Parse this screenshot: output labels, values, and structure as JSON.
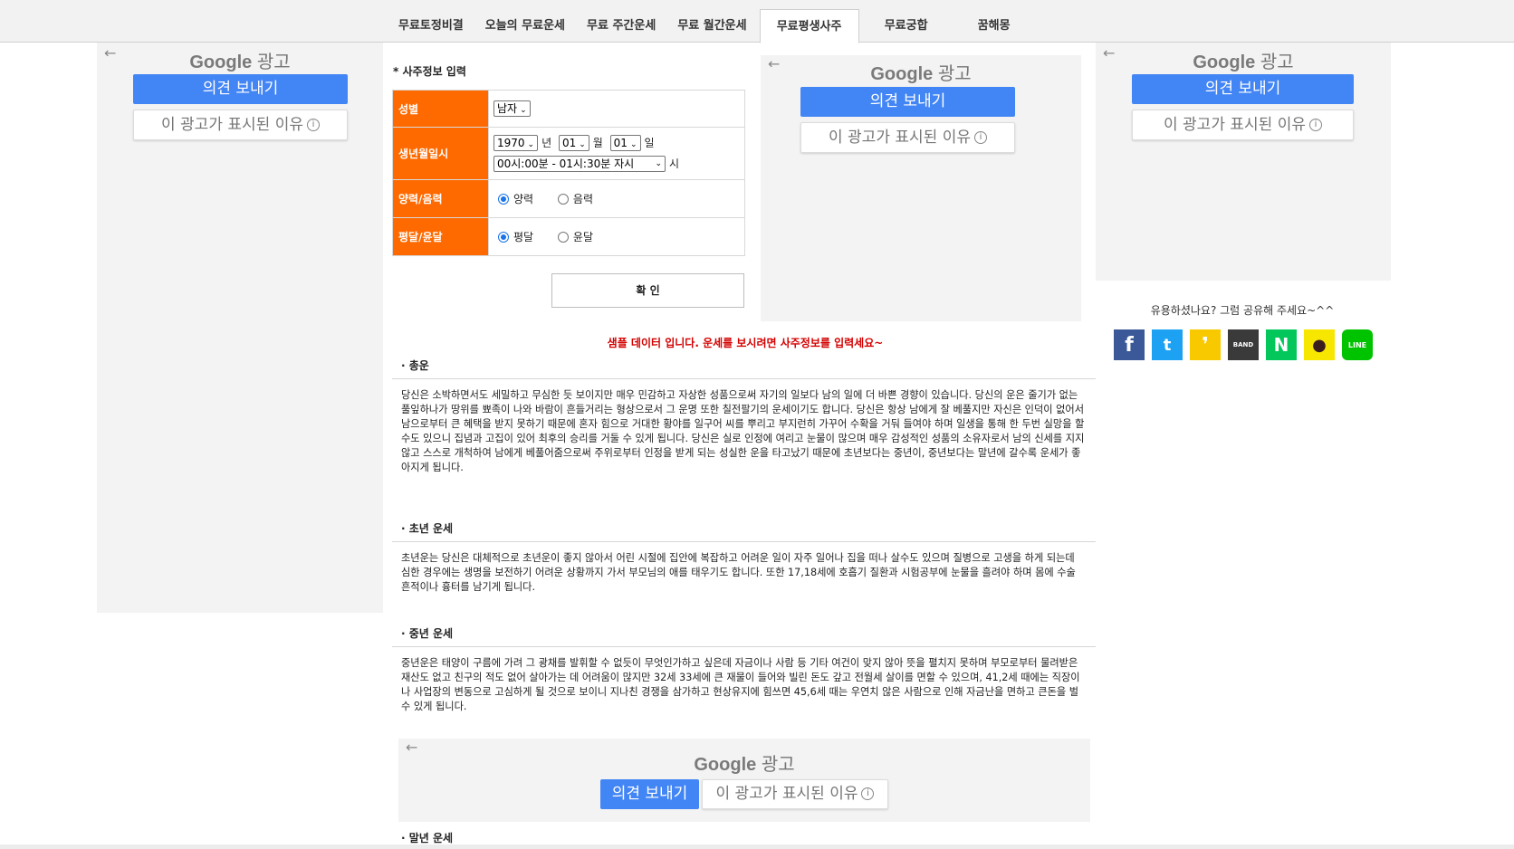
{
  "nav": {
    "tabs": [
      {
        "label": "무료토정비결"
      },
      {
        "label": "오늘의 무료운세"
      },
      {
        "label": "무료 주간운세"
      },
      {
        "label": "무료 월간운세"
      },
      {
        "label": "무료평생사주",
        "active": true
      },
      {
        "label": "무료궁합"
      },
      {
        "label": "꿈해몽"
      }
    ]
  },
  "ads": {
    "logo_google": "Google",
    "logo_ad": "광고",
    "feedback": "의견 보내기",
    "why": "이 광고가 표시된 이유",
    "back_arrow": "←"
  },
  "form": {
    "title": "* 사주정보 입력",
    "gender_label": "성별",
    "gender_value": "남자",
    "birth_label": "생년월일시",
    "year_value": "1970",
    "year_unit": "년",
    "month_value": "01",
    "month_unit": "월",
    "day_value": "01",
    "day_unit": "일",
    "time_value": "00시:00분 - 01시:30분 자시",
    "time_unit": "시",
    "calendar_label": "양력/음력",
    "solar": "양력",
    "lunar": "음력",
    "leap_label": "평달/윤달",
    "normal_month": "평달",
    "leap_month": "윤달",
    "confirm": "확 인"
  },
  "notice": "샘플 데이터 입니다. 운세를 보시려면 사주정보를 입력세요~",
  "sections": {
    "total": {
      "title": "· 총운",
      "body": "당신은 소박하면서도 세밀하고 무심한 듯 보이지만 매우 민감하고 자상한 성품으로써 자기의 일보다 남의 일에 더 바쁜 경향이 있습니다. 당신의 운은 줄기가 없는 풀잎하나가 땅위를 뾰족이 나와 바람이 흔들거리는 형상으로서 그 운명 또한 칠전팔기의 운세이기도 합니다. 당신은 항상 남에게 잘 베풀지만 자신은 인덕이 없어서 남으로부터 큰 혜택을 받지 못하기 때문에 혼자 힘으로 거대한 황야를 일구어 씨를 뿌리고 부지런히 가꾸어 수확을 거둬 들여야 하며 일생을 통해 한 두번 실망을 할 수도 있으니 집념과 고집이 있어 최후의 승리를 거둘 수 있게 됩니다. 당신은 실로 인정에 여리고 눈물이 많으며 매우 감성적인 성품의 소유자로서 남의 신세를 지지 않고 스스로 개척하여 남에게 베풀어줌으로써 주위로부터 인정을 받게 되는 성실한 운을 타고났기 때문에 초년보다는 중년이, 중년보다는 말년에 갈수록 운세가 좋아지게 됩니다."
    },
    "early": {
      "title": "· 초년 운세",
      "body": "초년운는 당신은 대체적으로 초년운이 좋지 않아서 어린 시절에 집안에 복잡하고 어려운 일이 자주 일어나 집을 떠나 살수도 있으며 질병으로 고생을 하게 되는데 심한 경우에는 생명을 보전하기 어려운 상황까지 가서 부모님의 애를 태우기도 합니다. 또한 17,18세에 호흡기 질환과 시험공부에 눈물을 흘려야 하며 몸에 수술 흔적이나 흉터를 남기게 됩니다."
    },
    "middle": {
      "title": "· 중년 운세",
      "body": "중년운은 태양이 구름에 가려 그 광채를 발휘할 수 없듯이 무엇인가하고 싶은데 자금이나 사람 등 기타 여건이 맞지 않아 뜻을 펼치지 못하며 부모로부터 물려받은 재산도 없고 친구의 적도 없어 살아가는 데 어려움이 많지만 32세 33세에 큰 재물이 들어와 빌린 돈도 갚고 전월세 살이를 면할 수 있으며, 41,2세 때에는 직장이나 사업장의 변동으로 고심하게 될 것으로 보이니 지나친 경쟁을 삼가하고 현상유지에 힘쓰면 45,6세 때는 우연치 않은 사람으로 인해 자금난을 면하고 큰돈을 벌 수 있게 됩니다."
    },
    "late": {
      "title": "· 말년 운세"
    }
  },
  "share": {
    "title": "유용하셨나요? 그럼 공유해 주세요~^^",
    "icons": [
      {
        "name": "facebook",
        "color": "#3b5998",
        "glyph": "f"
      },
      {
        "name": "twitter",
        "color": "#1da1f2",
        "glyph": "t"
      },
      {
        "name": "kakaostory",
        "color": "#f9c900",
        "glyph": "❜"
      },
      {
        "name": "band",
        "color": "#3a3a3a",
        "glyph": "BAND"
      },
      {
        "name": "naver",
        "color": "#03c75a",
        "glyph": "N"
      },
      {
        "name": "kakaotalk",
        "color": "#f7e600",
        "glyph": "●"
      },
      {
        "name": "line",
        "color": "#00c300",
        "glyph": "LINE"
      }
    ]
  },
  "colors": {
    "label_bg": "#ff6a00",
    "notice": "#d40000",
    "ad_blue": "#4285f4"
  }
}
